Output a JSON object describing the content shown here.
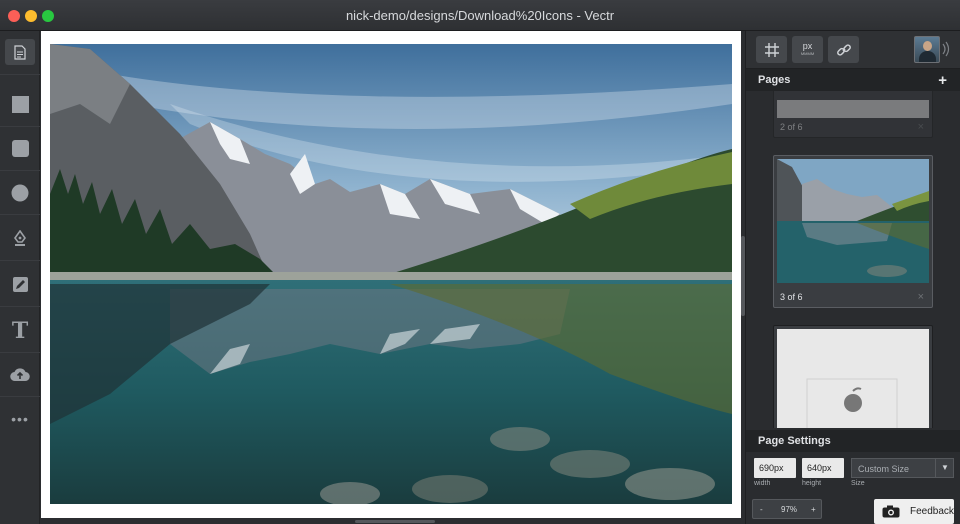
{
  "window": {
    "title": "nick-demo/designs/Download%20Icons - Vectr"
  },
  "left_toolbar": {
    "tools": [
      {
        "name": "page-tool",
        "icon": "document-icon"
      },
      {
        "name": "rectangle-tool",
        "icon": "square-icon"
      },
      {
        "name": "rounded-rectangle-tool",
        "icon": "rounded-square-icon"
      },
      {
        "name": "ellipse-tool",
        "icon": "circle-icon"
      },
      {
        "name": "pen-tool",
        "icon": "pen-nib-icon"
      },
      {
        "name": "pencil-tool",
        "icon": "pencil-icon"
      },
      {
        "name": "text-tool",
        "icon": "text-t-icon",
        "glyph": "T"
      },
      {
        "name": "upload-tool",
        "icon": "cloud-upload-icon"
      },
      {
        "name": "more-tool",
        "icon": "more-dots-icon",
        "glyph": "•••"
      }
    ]
  },
  "right_toolbar": {
    "px_button": {
      "label": "px",
      "sublabel": "MMMM"
    }
  },
  "pages": {
    "header": "Pages",
    "add_glyph": "+",
    "items": [
      {
        "label": "2 of 6"
      },
      {
        "label": "3 of 6"
      },
      {
        "label": ""
      }
    ],
    "close_glyph": "×"
  },
  "page_settings": {
    "header": "Page Settings",
    "width": {
      "value": "690px",
      "label": "width"
    },
    "height": {
      "value": "640px",
      "label": "height"
    },
    "size": {
      "value": "Custom Size",
      "label": "Size"
    }
  },
  "zoom": {
    "minus": "-",
    "value": "97%",
    "plus": "+"
  },
  "feedback": {
    "label": "Feedback"
  },
  "colors": {
    "accent": "#3f9ade",
    "panel": "#2a2c2f",
    "toolbar": "#2f3134"
  }
}
